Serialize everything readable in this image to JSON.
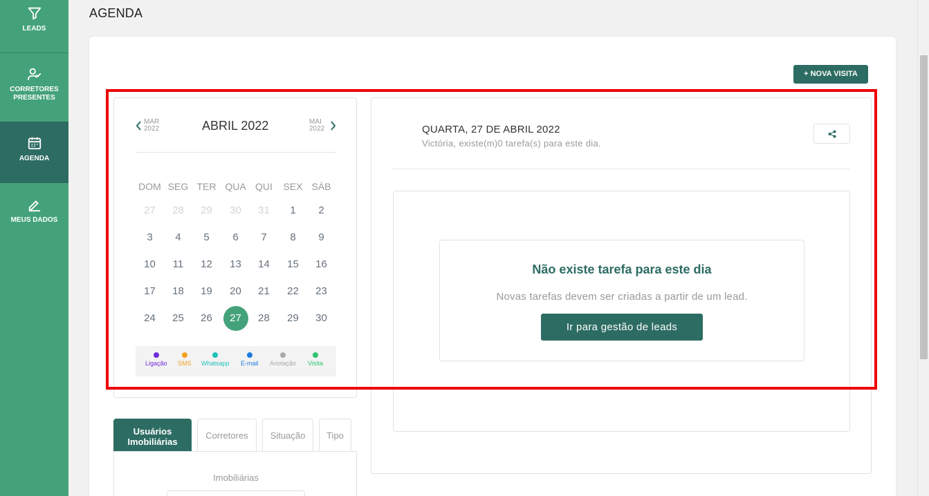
{
  "sidebar": {
    "items": [
      {
        "label": "LEADS",
        "icon": "filter-icon"
      },
      {
        "label": "CORRETORES PRESENTES",
        "icon": "user-check-icon"
      },
      {
        "label": "AGENDA",
        "icon": "calendar-icon",
        "active": true
      },
      {
        "label": "MEUS DADOS",
        "icon": "pencil-icon"
      }
    ]
  },
  "page": {
    "title": "AGENDA"
  },
  "toolbar": {
    "new_visit_label": "+ NOVA VISITA"
  },
  "calendar": {
    "prev": {
      "month": "MAR",
      "year": "2022"
    },
    "next": {
      "month": "MAI",
      "year": "2022"
    },
    "title": "ABRIL 2022",
    "weekdays": [
      "DOM",
      "SEG",
      "TER",
      "QUA",
      "QUI",
      "SEX",
      "SÁB"
    ],
    "weeks": [
      [
        "27",
        "28",
        "29",
        "30",
        "31",
        "1",
        "2"
      ],
      [
        "3",
        "4",
        "5",
        "6",
        "7",
        "8",
        "9"
      ],
      [
        "10",
        "11",
        "12",
        "13",
        "14",
        "15",
        "16"
      ],
      [
        "17",
        "18",
        "19",
        "20",
        "21",
        "22",
        "23"
      ],
      [
        "24",
        "25",
        "26",
        "27",
        "28",
        "29",
        "30"
      ]
    ],
    "selected_day": "27",
    "legend": [
      {
        "label": "Ligação",
        "color": "#6f2bd9"
      },
      {
        "label": "SMS",
        "color": "#f4a11d"
      },
      {
        "label": "Whatsapp",
        "color": "#1fc0b8"
      },
      {
        "label": "E-mail",
        "color": "#1f7ae0"
      },
      {
        "label": "Anotação",
        "color": "#aaaaaa"
      },
      {
        "label": "Visita",
        "color": "#2cc46e"
      }
    ]
  },
  "filters": {
    "tabs": [
      "Usuários Imobiliárias",
      "Corretores",
      "Situação",
      "Tipo"
    ],
    "active_tab": 0,
    "section_label": "Imobiliárias"
  },
  "day_view": {
    "title": "QUARTA, 27 DE ABRIL 2022",
    "subtitle": "Victória, existe(m)0 tarefa(s) para este dia.",
    "empty": {
      "title": "Não existe tarefa para este dia",
      "message": "Novas tarefas devem ser criadas a partir de um lead.",
      "button_label": "Ir para gestão de leads"
    }
  },
  "colors": {
    "sidebar": "#44a27a",
    "primary_dark": "#2d6c63",
    "highlight": "#ee0000"
  }
}
